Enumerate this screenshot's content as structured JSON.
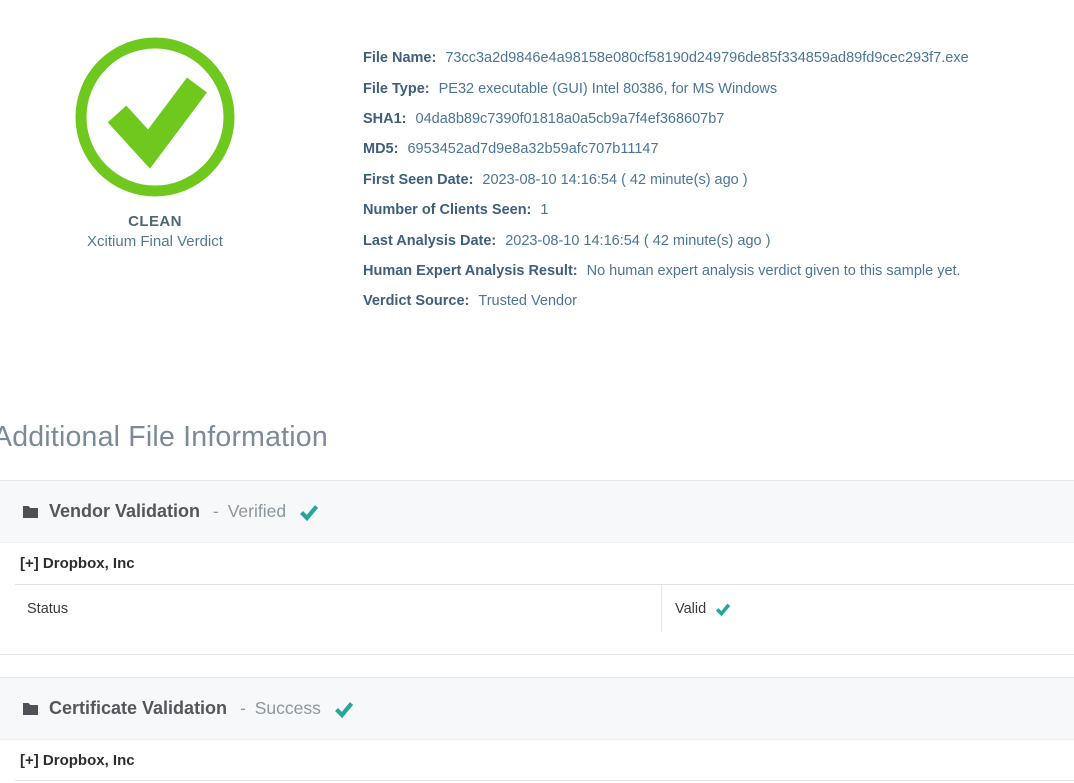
{
  "verdict": {
    "status": "CLEAN",
    "source": "Xcitium Final Verdict"
  },
  "file_details": [
    {
      "label": "File Name:",
      "value": "73cc3a2d9846e4a98158e080cf58190d249796de85f334859ad89fd9cec293f7.exe"
    },
    {
      "label": "File Type:",
      "value": "PE32 executable (GUI) Intel 80386, for MS Windows"
    },
    {
      "label": "SHA1:",
      "value": "04da8b89c7390f01818a0a5cb9a7f4ef368607b7"
    },
    {
      "label": "MD5:",
      "value": "6953452ad7d9e8a32b59afc707b11147"
    },
    {
      "label": "First Seen Date:",
      "value": "2023-08-10 14:16:54 ( 42 minute(s) ago )"
    },
    {
      "label": "Number of Clients Seen:",
      "value": "1"
    },
    {
      "label": "Last Analysis Date:",
      "value": "2023-08-10 14:16:54 ( 42 minute(s) ago )"
    },
    {
      "label": "Human Expert Analysis Result:",
      "value": "No human expert analysis verdict given to this sample yet."
    },
    {
      "label": "Verdict Source:",
      "value": "Trusted Vendor"
    }
  ],
  "section_heading": "Additional File Information",
  "panels": [
    {
      "title": "Vendor Validation",
      "separator": "-",
      "status": "Verified",
      "vendor": "[+] Dropbox, Inc",
      "rows": [
        {
          "key": "Status",
          "value": "Valid"
        }
      ]
    },
    {
      "title": "Certificate Validation",
      "separator": "-",
      "status": "Success",
      "vendor": "[+] Dropbox, Inc"
    }
  ],
  "icons": {
    "verdict_badge": "check-circle-icon",
    "panel_header": "folder-icon",
    "success_mark": "check-icon"
  },
  "colors": {
    "verdict_green": "#6ec81e",
    "check_teal": "#26a69a",
    "detail_label_blue": "#3d5f7b",
    "detail_value_blue": "#4b7598",
    "heading_gray": "#7b8a9a",
    "panel_head_bg": "#f6f8f9"
  }
}
